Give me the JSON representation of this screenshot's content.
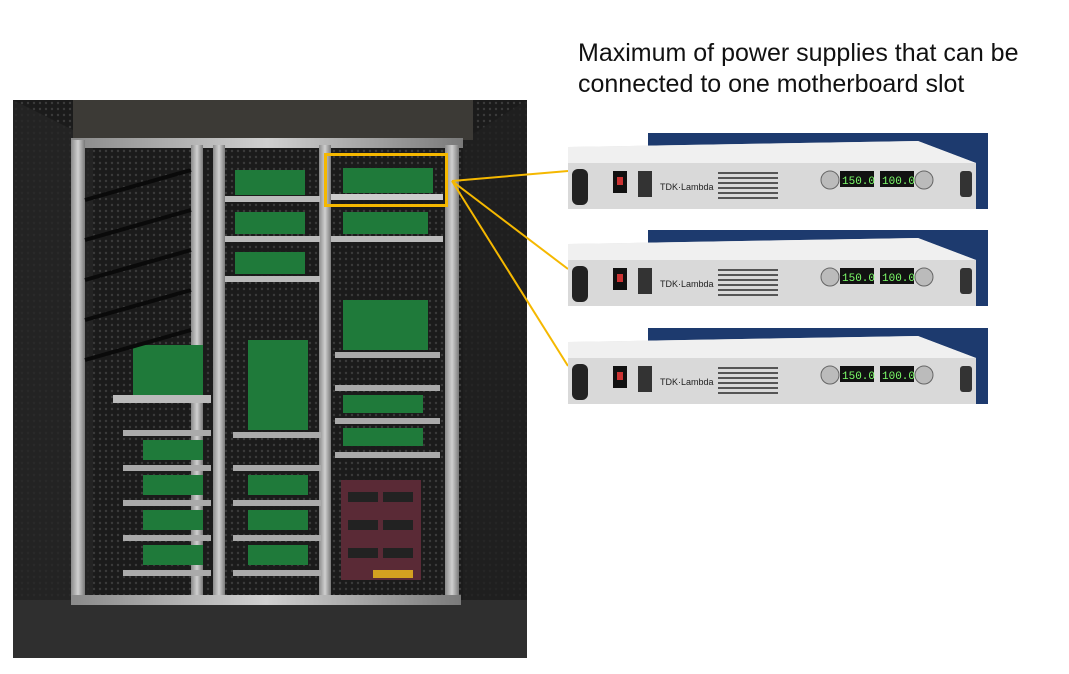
{
  "caption": {
    "line1": "Maximum of power supplies that can be",
    "line2": "connected to one motherboard slot"
  },
  "photo": {
    "subject": "burn-in oven rack with motherboard slots",
    "highlight_color": "#f5b800"
  },
  "power_supplies": [
    {
      "brand": "TDK·Lambda",
      "voltage_display": "150.0",
      "current_display": "100.0"
    },
    {
      "brand": "TDK·Lambda",
      "voltage_display": "150.0",
      "current_display": "100.0"
    },
    {
      "brand": "TDK·Lambda",
      "voltage_display": "150.0",
      "current_display": "100.0"
    }
  ],
  "colors": {
    "connector": "#f5b800",
    "psu_backdrop": "#1d3a6e",
    "display_green": "#7dff6a"
  }
}
